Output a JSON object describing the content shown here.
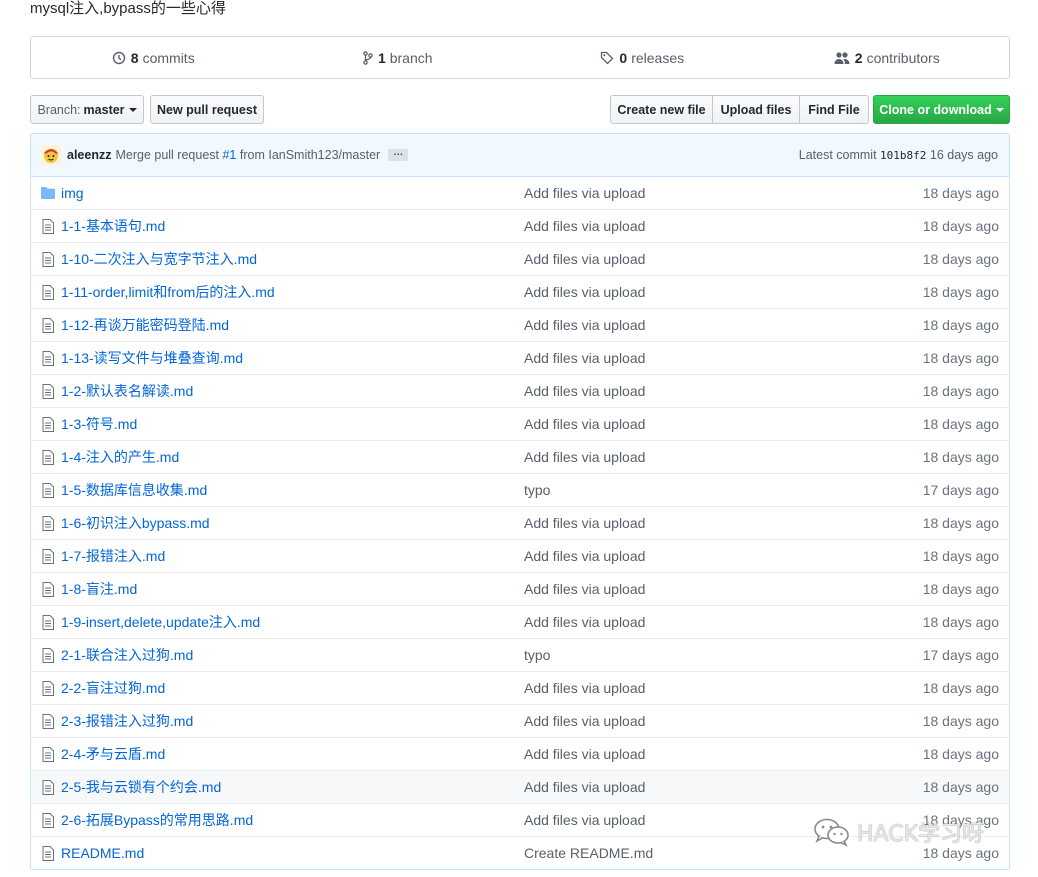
{
  "repo": {
    "description": "mysql注入,bypass的一些心得"
  },
  "summary": {
    "commits_count": "8",
    "commits_label": "commits",
    "branch_count": "1",
    "branch_label": "branch",
    "releases_count": "0",
    "releases_label": "releases",
    "contributors_count": "2",
    "contributors_label": "contributors"
  },
  "toolbar": {
    "branch_prefix": "Branch:",
    "branch_name": "master",
    "new_pr": "New pull request",
    "create_file": "Create new file",
    "upload_files": "Upload files",
    "find_file": "Find File",
    "clone": "Clone or download"
  },
  "commit": {
    "author": "aleenzz",
    "message_prefix": "Merge pull request",
    "pr_number": "#1",
    "message_suffix": "from IanSmith123/master",
    "ellipsis": "…",
    "latest_label": "Latest commit",
    "sha": "101b8f2",
    "age": "16 days ago"
  },
  "files": [
    {
      "type": "dir",
      "name": "img",
      "message": "Add files via upload",
      "age": "18 days ago"
    },
    {
      "type": "file",
      "name": "1-1-基本语句.md",
      "message": "Add files via upload",
      "age": "18 days ago"
    },
    {
      "type": "file",
      "name": "1-10-二次注入与宽字节注入.md",
      "message": "Add files via upload",
      "age": "18 days ago"
    },
    {
      "type": "file",
      "name": "1-11-order,limit和from后的注入.md",
      "message": "Add files via upload",
      "age": "18 days ago"
    },
    {
      "type": "file",
      "name": "1-12-再谈万能密码登陆.md",
      "message": "Add files via upload",
      "age": "18 days ago"
    },
    {
      "type": "file",
      "name": "1-13-读写文件与堆叠查询.md",
      "message": "Add files via upload",
      "age": "18 days ago"
    },
    {
      "type": "file",
      "name": "1-2-默认表名解读.md",
      "message": "Add files via upload",
      "age": "18 days ago"
    },
    {
      "type": "file",
      "name": "1-3-符号.md",
      "message": "Add files via upload",
      "age": "18 days ago"
    },
    {
      "type": "file",
      "name": "1-4-注入的产生.md",
      "message": "Add files via upload",
      "age": "18 days ago"
    },
    {
      "type": "file",
      "name": "1-5-数据库信息收集.md",
      "message": "typo",
      "age": "17 days ago"
    },
    {
      "type": "file",
      "name": "1-6-初识注入bypass.md",
      "message": "Add files via upload",
      "age": "18 days ago"
    },
    {
      "type": "file",
      "name": "1-7-报错注入.md",
      "message": "Add files via upload",
      "age": "18 days ago"
    },
    {
      "type": "file",
      "name": "1-8-盲注.md",
      "message": "Add files via upload",
      "age": "18 days ago"
    },
    {
      "type": "file",
      "name": "1-9-insert,delete,update注入.md",
      "message": "Add files via upload",
      "age": "18 days ago"
    },
    {
      "type": "file",
      "name": "2-1-联合注入过狗.md",
      "message": "typo",
      "age": "17 days ago"
    },
    {
      "type": "file",
      "name": "2-2-盲注过狗.md",
      "message": "Add files via upload",
      "age": "18 days ago"
    },
    {
      "type": "file",
      "name": "2-3-报错注入过狗.md",
      "message": "Add files via upload",
      "age": "18 days ago"
    },
    {
      "type": "file",
      "name": "2-4-矛与云盾.md",
      "message": "Add files via upload",
      "age": "18 days ago"
    },
    {
      "type": "file",
      "name": "2-5-我与云锁有个约会.md",
      "message": "Add files via upload",
      "age": "18 days ago"
    },
    {
      "type": "file",
      "name": "2-6-拓展Bypass的常用思路.md",
      "message": "Add files via upload",
      "age": "18 days ago"
    },
    {
      "type": "file",
      "name": "README.md",
      "message": "Create README.md",
      "age": "18 days ago"
    }
  ],
  "watermark": {
    "text": "HACK学习呀",
    "icon": "wechat-icon"
  },
  "colors": {
    "link": "#0366d6",
    "green_button": "#28a745",
    "commit_bar_bg": "#f1f8ff"
  }
}
